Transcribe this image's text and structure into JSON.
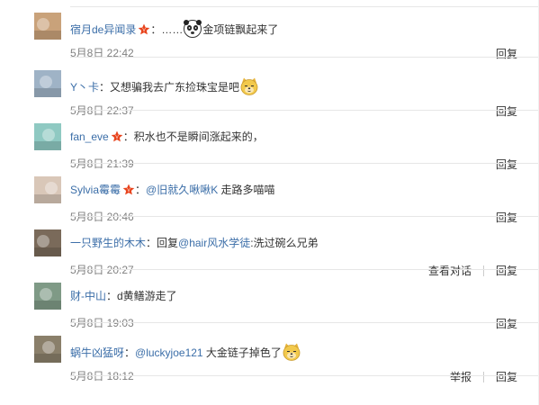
{
  "comments": [
    {
      "user": "宿月de异闻录",
      "vip": true,
      "segments": [
        {
          "text": "：……",
          "type": "plain"
        },
        {
          "type": "emoji",
          "emoji": "panda-face-icon"
        },
        {
          "text": "金项链飘起来了",
          "type": "plain"
        }
      ],
      "time": "5月8日 22:42",
      "actions": [
        "回复"
      ],
      "avatar_color": "#c9a27a"
    },
    {
      "user": "Y丶卡",
      "vip": false,
      "segments": [
        {
          "text": "：又想骗我去广东捡珠宝是吧",
          "type": "plain"
        },
        {
          "type": "emoji",
          "emoji": "doge-icon"
        }
      ],
      "time": "5月8日 22:37",
      "actions": [
        "回复"
      ],
      "avatar_color": "#9fb3c6"
    },
    {
      "user": "fan_eve",
      "vip": true,
      "segments": [
        {
          "text": "：积水也不是瞬间涨起来的，",
          "type": "plain"
        }
      ],
      "time": "5月8日 21:39",
      "actions": [
        "回复"
      ],
      "avatar_color": "#8fc9c2"
    },
    {
      "user": "Sylvia霉霉",
      "vip": true,
      "segments": [
        {
          "text": "：",
          "type": "plain"
        },
        {
          "text": "@旧就久啾啾K",
          "type": "mention"
        },
        {
          "text": " 走路多喵喵",
          "type": "plain"
        }
      ],
      "time": "5月8日 20:46",
      "actions": [
        "回复"
      ],
      "avatar_color": "#d9c7b8"
    },
    {
      "user": "一只野生的木木",
      "vip": false,
      "segments": [
        {
          "text": "：回复",
          "type": "plain"
        },
        {
          "text": "@hair风水学徒",
          "type": "mention"
        },
        {
          "text": ":洗过碗么兄弟",
          "type": "plain"
        }
      ],
      "time": "5月8日 20:27",
      "actions": [
        "查看对话",
        "回复"
      ],
      "avatar_color": "#7a6a5a"
    },
    {
      "user": "财-中山",
      "vip": false,
      "segments": [
        {
          "text": "：d黄鳝游走了",
          "type": "plain"
        }
      ],
      "time": "5月8日 19:03",
      "actions": [
        "回复"
      ],
      "avatar_color": "#7f9a86"
    },
    {
      "user": "蜗牛凶猛呀",
      "vip": false,
      "segments": [
        {
          "text": "：",
          "type": "plain"
        },
        {
          "text": "@luckyjoe121",
          "type": "mention"
        },
        {
          "text": " 大金链子掉色了",
          "type": "plain"
        },
        {
          "type": "emoji",
          "emoji": "doge-icon"
        }
      ],
      "time": "5月8日 18:12",
      "actions": [
        "举报",
        "回复"
      ],
      "avatar_color": "#8a7f6a"
    }
  ],
  "colors": {
    "username": "#3b6ea8",
    "text": "#333333",
    "meta": "#808080",
    "divider": "#e6e6e6",
    "vip_badge": "#e8431c"
  }
}
